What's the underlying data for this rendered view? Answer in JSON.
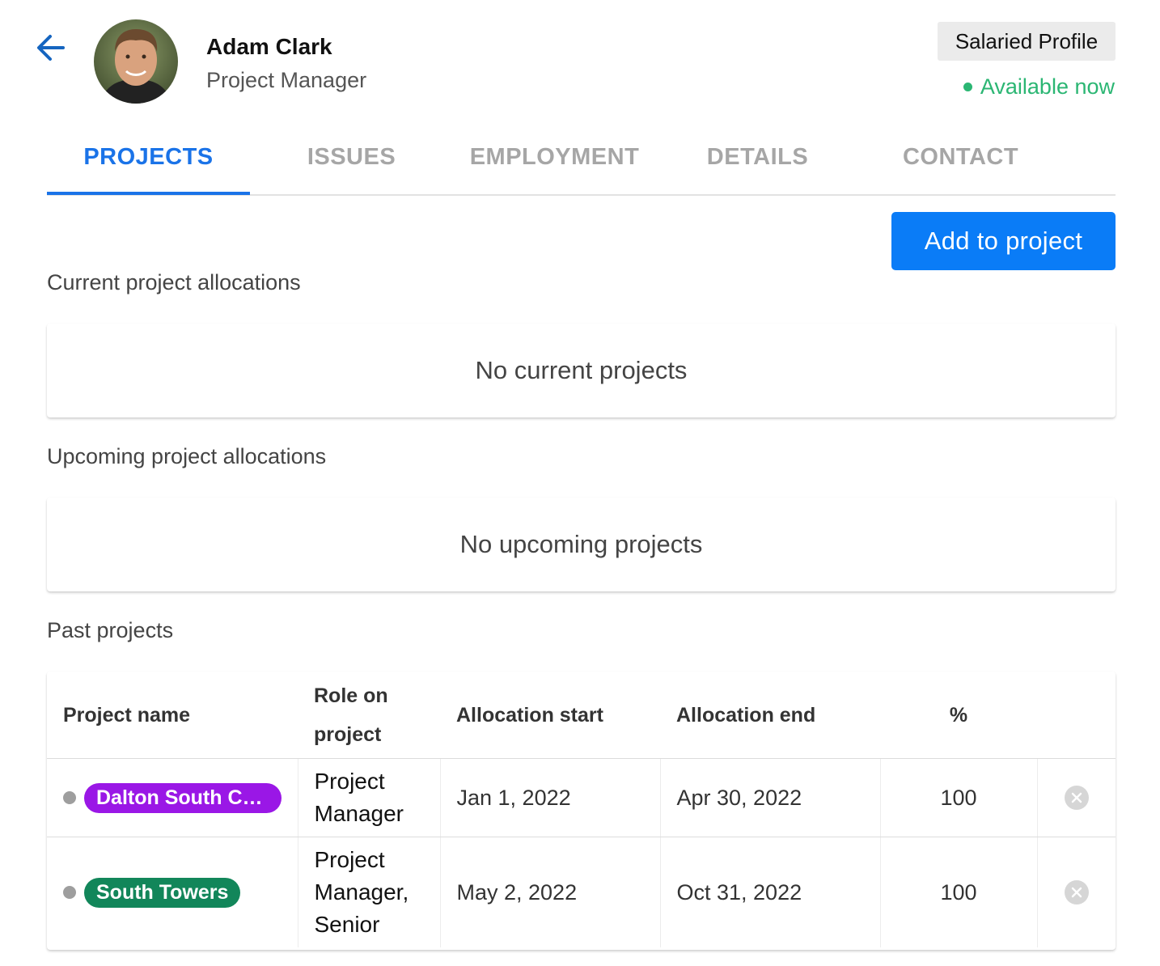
{
  "header": {
    "name": "Adam Clark",
    "title": "Project Manager",
    "profile_type": "Salaried Profile",
    "availability": "Available now"
  },
  "tabs": [
    {
      "label": "PROJECTS",
      "active": true
    },
    {
      "label": "ISSUES",
      "active": false
    },
    {
      "label": "EMPLOYMENT",
      "active": false
    },
    {
      "label": "DETAILS",
      "active": false
    },
    {
      "label": "CONTACT",
      "active": false
    }
  ],
  "actions": {
    "add_to_project": "Add to project"
  },
  "current": {
    "title": "Current project allocations",
    "empty": "No current projects"
  },
  "upcoming": {
    "title": "Upcoming project allocations",
    "empty": "No upcoming projects"
  },
  "past": {
    "title": "Past projects",
    "columns": {
      "project_name": "Project name",
      "role_line1": "Role on",
      "role_line2": "project",
      "start": "Allocation start",
      "end": "Allocation end",
      "percent": "%"
    },
    "rows": [
      {
        "project": "Dalton South Co...",
        "role_line1": "Project",
        "role_line2": "Manager",
        "role_line3": "",
        "start": "Jan 1, 2022",
        "end": "Apr 30, 2022",
        "percent": "100"
      },
      {
        "project": "South Towers",
        "role_line1": "Project",
        "role_line2": "Manager,",
        "role_line3": "Senior",
        "start": "May 2, 2022",
        "end": "Oct 31, 2022",
        "percent": "100"
      }
    ]
  },
  "colors": {
    "accent": "#1a73e8",
    "button": "#0a7cf7",
    "available": "#2bb673",
    "chip_dalton": "#9a17e6",
    "chip_south_towers": "#12865a"
  },
  "icons": {
    "back": "arrow-left-icon",
    "remove": "close-circle-icon",
    "avatar": "user-avatar"
  }
}
